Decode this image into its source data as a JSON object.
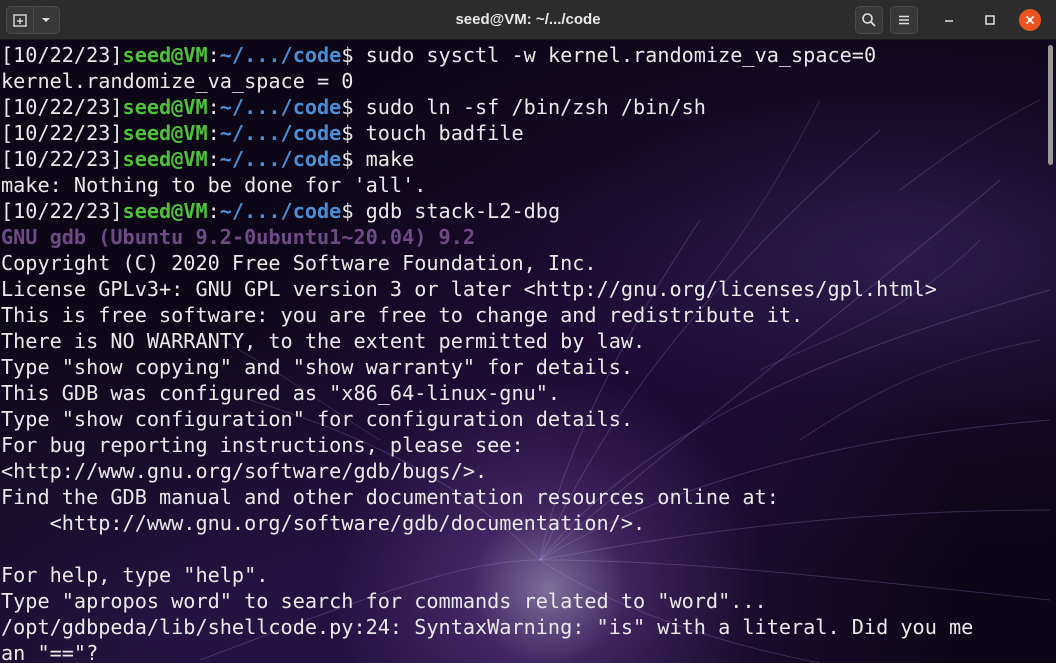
{
  "window": {
    "title": "seed@VM: ~/.../code",
    "accent_close": "#e95420"
  },
  "titlebar": {
    "new_tab_icon": "new-tab-icon",
    "menu_dropdown_icon": "chevron-down-icon",
    "search_icon": "search-icon",
    "hamburger_icon": "hamburger-menu-icon",
    "minimize_icon": "minimize-icon",
    "maximize_icon": "maximize-icon",
    "close_icon": "close-icon"
  },
  "colors": {
    "prompt_user": "#4fc03a",
    "prompt_path": "#4a8fd6",
    "gdb_banner": "#6e4a86",
    "text": "#e9e9e9"
  },
  "terminal": {
    "prompt": {
      "date": "[10/22/23]",
      "user": "seed@VM",
      "colon": ":",
      "path": "~/.../code",
      "symbol": "$"
    },
    "cmd1": " sudo sysctl -w kernel.randomize_va_space=0",
    "out1": "kernel.randomize_va_space = 0",
    "cmd2": " sudo ln -sf /bin/zsh /bin/sh",
    "cmd3": " touch badfile",
    "cmd4": " make",
    "out4": "make: Nothing to be done for 'all'.",
    "cmd5": " gdb stack-L2-dbg",
    "gdb_banner": "GNU gdb (Ubuntu 9.2-0ubuntu1~20.04) 9.2",
    "gdb_lines": [
      "Copyright (C) 2020 Free Software Foundation, Inc.",
      "License GPLv3+: GNU GPL version 3 or later <http://gnu.org/licenses/gpl.html>",
      "This is free software: you are free to change and redistribute it.",
      "There is NO WARRANTY, to the extent permitted by law.",
      "Type \"show copying\" and \"show warranty\" for details.",
      "This GDB was configured as \"x86_64-linux-gnu\".",
      "Type \"show configuration\" for configuration details.",
      "For bug reporting instructions, please see:",
      "<http://www.gnu.org/software/gdb/bugs/>.",
      "Find the GDB manual and other documentation resources online at:",
      "    <http://www.gnu.org/software/gdb/documentation/>."
    ],
    "help_lines": [
      "For help, type \"help\".",
      "Type \"apropos word\" to search for commands related to \"word\"...",
      "/opt/gdbpeda/lib/shellcode.py:24: SyntaxWarning: \"is\" with a literal. Did you me",
      "an \"==\"?"
    ]
  }
}
